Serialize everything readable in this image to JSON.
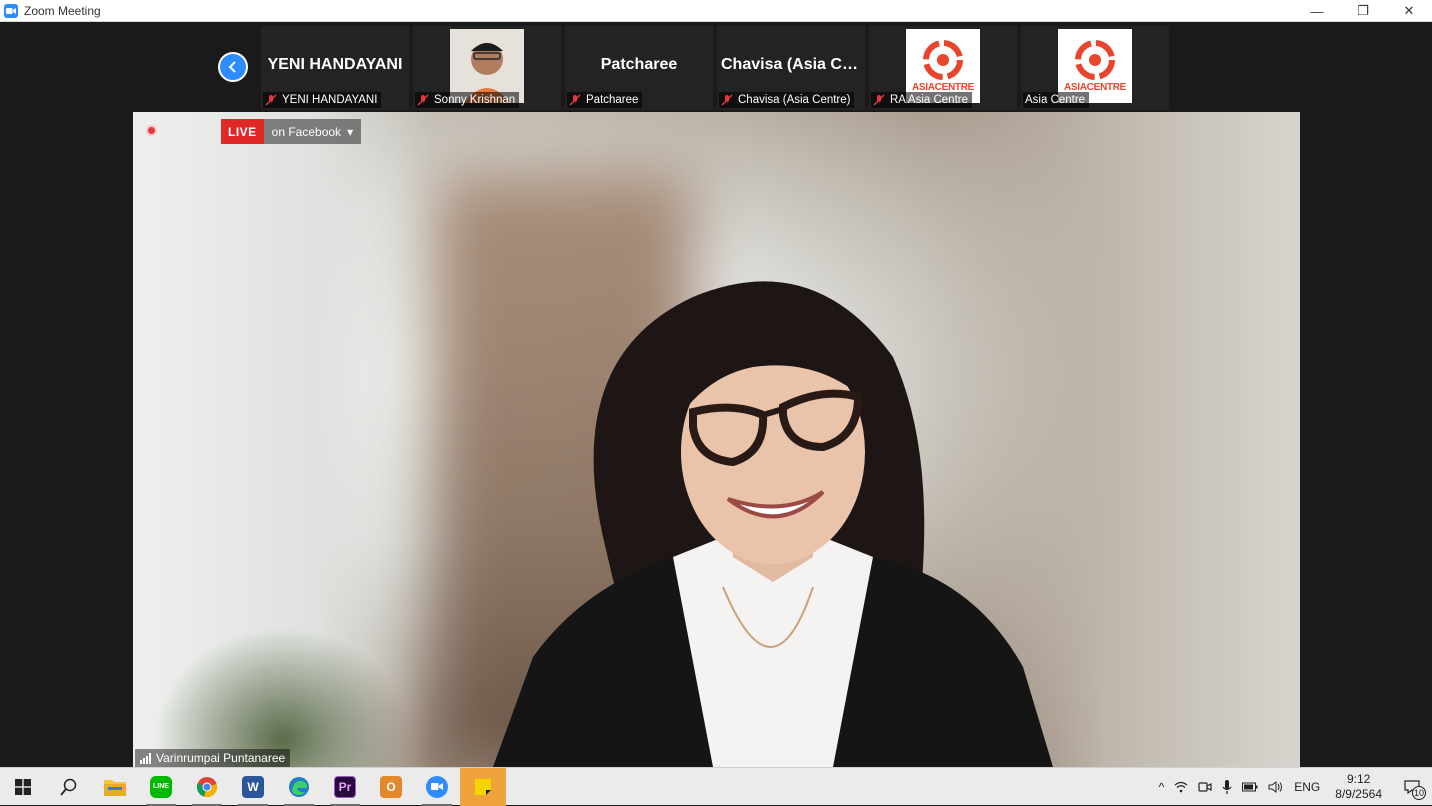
{
  "window": {
    "title": "Zoom Meeting",
    "minimize_glyph": "—",
    "restore_glyph": "❐",
    "close_glyph": "✕"
  },
  "gallery": {
    "prev_icon": "chevron-left-icon",
    "tiles": [
      {
        "big_name": "YENI HANDAYANI",
        "label": "YENI HANDAYANI",
        "muted": true,
        "kind": "name"
      },
      {
        "big_name": "",
        "label": "Sonny Krishnan",
        "muted": true,
        "kind": "photo"
      },
      {
        "big_name": "Patcharee",
        "label": "Patcharee",
        "muted": true,
        "kind": "name"
      },
      {
        "big_name": "Chavisa  (Asia  Ce...",
        "label": "Chavisa (Asia Centre)",
        "muted": true,
        "kind": "name"
      },
      {
        "big_name": "",
        "label": "RA Asia Centre",
        "muted": true,
        "kind": "logo",
        "logo_text": "ASIACENTRE"
      },
      {
        "big_name": "",
        "label": "Asia Centre",
        "muted": false,
        "kind": "logo",
        "logo_text": "ASIACENTRE"
      }
    ]
  },
  "main_video": {
    "live_badge": "LIVE",
    "live_target": "on Facebook",
    "live_dropdown_glyph": "▾",
    "speaker_name": "Varinrumpai Puntanaree"
  },
  "taskbar": {
    "apps": [
      {
        "name": "start",
        "icon": "windows-icon"
      },
      {
        "name": "search",
        "icon": "search-icon"
      },
      {
        "name": "file-explorer",
        "icon": "folder-icon",
        "color": "#f4c542"
      },
      {
        "name": "line",
        "icon": "line-icon",
        "color": "#00b900",
        "text": "LINE",
        "running": true
      },
      {
        "name": "chrome",
        "icon": "chrome-icon",
        "running": true
      },
      {
        "name": "word",
        "icon": "word-icon",
        "color": "#2b579a",
        "text": "W",
        "running": true
      },
      {
        "name": "edge",
        "icon": "edge-icon",
        "color": "#1e7dc8",
        "running": true
      },
      {
        "name": "premiere",
        "icon": "premiere-icon",
        "color": "#2a0a3b",
        "text": "Pr",
        "running": true
      },
      {
        "name": "outlook",
        "icon": "outlook-icon",
        "color": "#e3882b",
        "text": "O"
      },
      {
        "name": "zoom",
        "icon": "zoom-icon",
        "color": "#2d8cff",
        "running": true
      },
      {
        "name": "sticky-notes",
        "icon": "sticky-notes-icon",
        "color": "#f5d400",
        "active": true
      }
    ],
    "tray": {
      "chevron": "^",
      "language": "ENG",
      "time": "9:12",
      "date": "8/9/2564",
      "notification_count": "10"
    }
  },
  "colors": {
    "zoom_blue": "#2d8cff",
    "live_red": "#e02828",
    "mute_red": "#e0393e",
    "asia_centre_orange": "#e8452c"
  }
}
